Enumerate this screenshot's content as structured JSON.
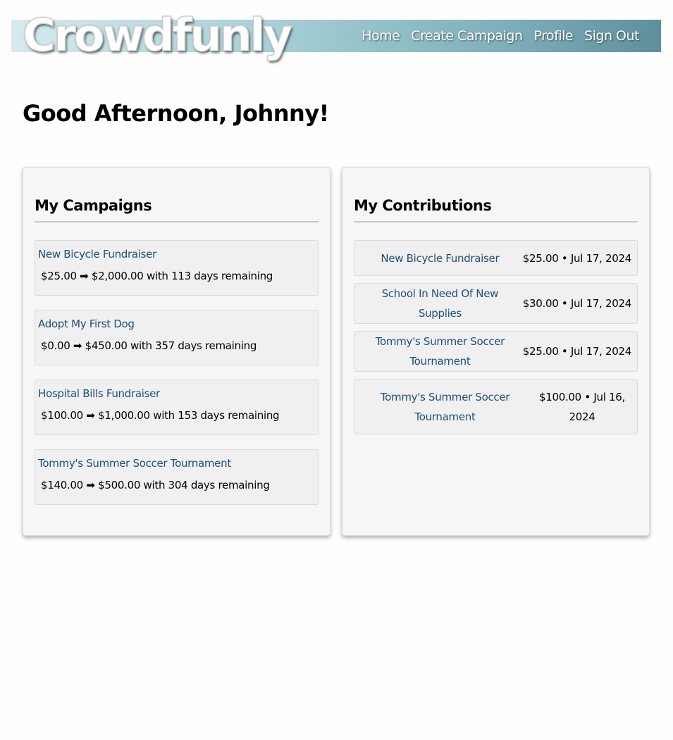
{
  "header": {
    "logo": "Crowdfunly",
    "nav": [
      {
        "label": "Home"
      },
      {
        "label": "Create Campaign"
      },
      {
        "label": "Profile"
      },
      {
        "label": "Sign Out"
      }
    ]
  },
  "greeting": "Good Afternoon, Johnny!",
  "campaigns": {
    "title": "My Campaigns",
    "items": [
      {
        "name": "New Bicycle Fundraiser",
        "progress": "$25.00 ➡ $2,000.00 with 113 days remaining"
      },
      {
        "name": "Adopt My First Dog",
        "progress": "$0.00 ➡ $450.00 with 357 days remaining"
      },
      {
        "name": "Hospital Bills Fundraiser",
        "progress": "$100.00 ➡ $1,000.00 with 153 days remaining"
      },
      {
        "name": "Tommy's Summer Soccer Tournament",
        "progress": "$140.00 ➡ $500.00 with 304 days remaining"
      }
    ]
  },
  "contributions": {
    "title": "My Contributions",
    "items": [
      {
        "name": "New Bicycle Fundraiser",
        "meta": "$25.00 • Jul 17, 2024"
      },
      {
        "name": "School In Need Of New Supplies",
        "meta": "$30.00 • Jul 17, 2024"
      },
      {
        "name": "Tommy's Summer Soccer Tournament",
        "meta": "$25.00 • Jul 17, 2024"
      },
      {
        "name": "Tommy's Summer Soccer Tournament",
        "meta": "$100.00 • Jul 16, 2024"
      }
    ]
  },
  "colors": {
    "link": "#1f4e7a",
    "header_gradient_start": "#d6eaee",
    "header_gradient_end": "#5f8f9b"
  }
}
